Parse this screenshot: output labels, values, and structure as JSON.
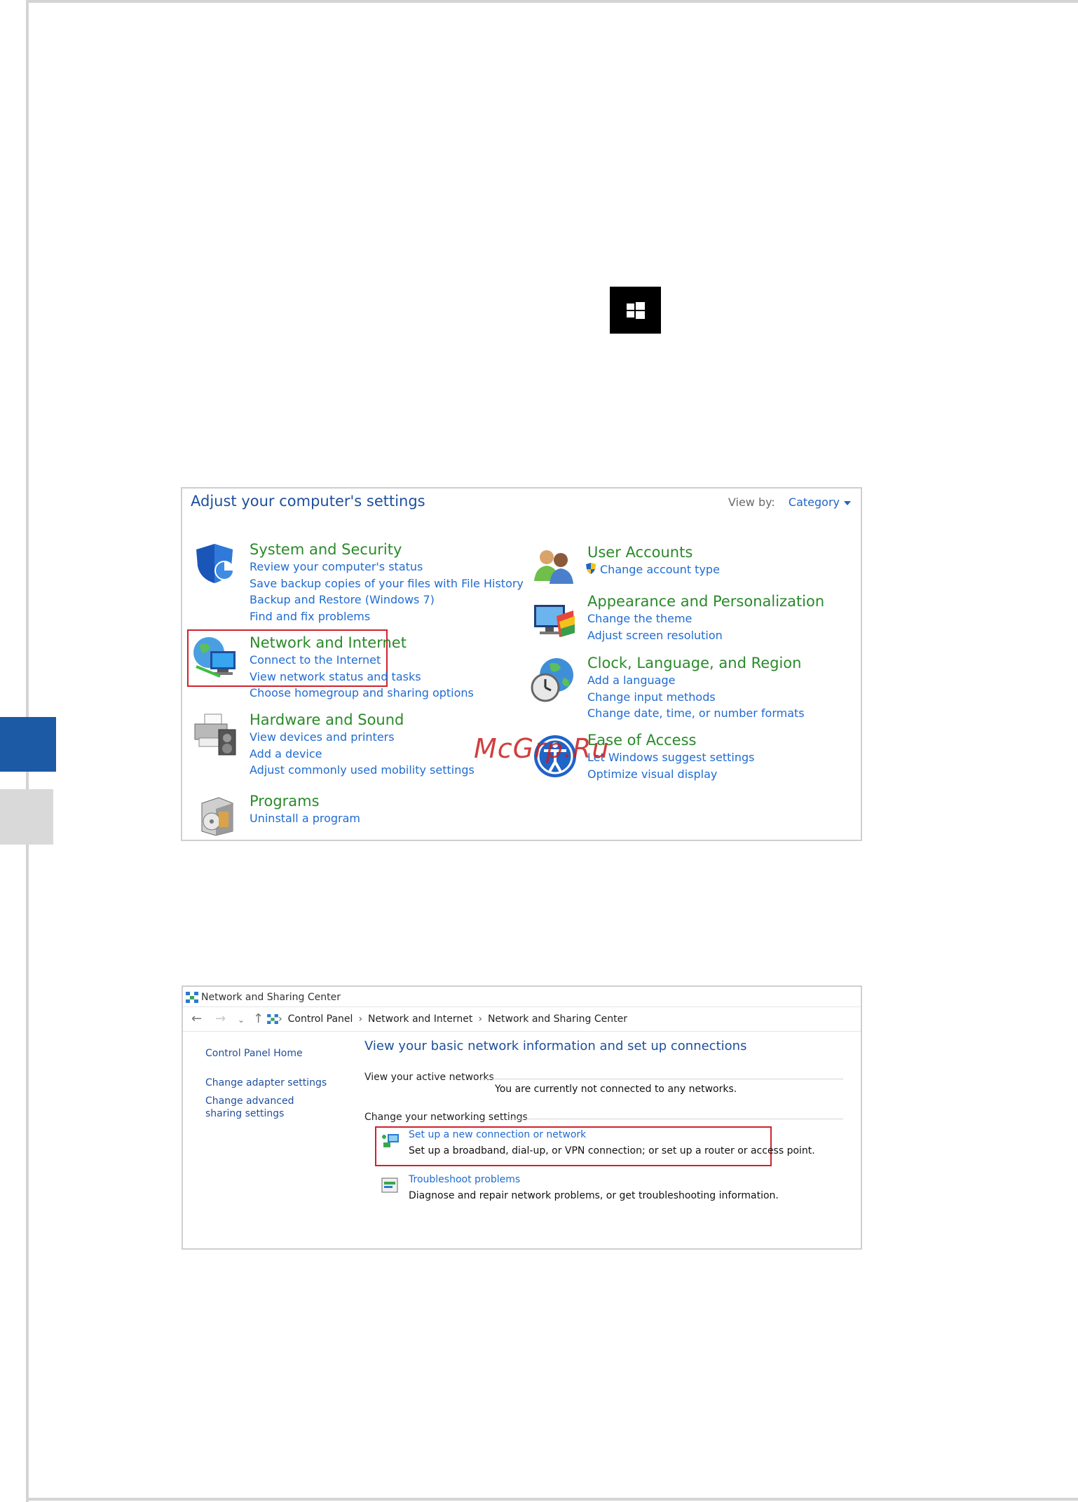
{
  "control_panel": {
    "title": "Adjust your computer's settings",
    "view_by_label": "View by:",
    "view_by_value": "Category",
    "categories": [
      {
        "heading": "System and Security",
        "links": [
          "Review your computer's status",
          "Save backup copies of your files with File History",
          "Backup and Restore (Windows 7)",
          "Find and fix problems"
        ]
      },
      {
        "heading": "Network and Internet",
        "links": [
          "Connect to the Internet",
          "View network status and tasks",
          "Choose homegroup and sharing options"
        ]
      },
      {
        "heading": "Hardware and Sound",
        "links": [
          "View devices and printers",
          "Add a device",
          "Adjust commonly used mobility settings"
        ]
      },
      {
        "heading": "Programs",
        "links": [
          "Uninstall a program"
        ]
      },
      {
        "heading": "User Accounts",
        "links": [
          "Change account type"
        ]
      },
      {
        "heading": "Appearance and Personalization",
        "links": [
          "Change the theme",
          "Adjust screen resolution"
        ]
      },
      {
        "heading": "Clock, Language, and Region",
        "links": [
          "Add a language",
          "Change input methods",
          "Change date, time, or number formats"
        ]
      },
      {
        "heading": "Ease of Access",
        "links": [
          "Let Windows suggest settings",
          "Optimize visual display"
        ]
      }
    ]
  },
  "network_center": {
    "window_title": "Network and Sharing Center",
    "breadcrumb": [
      "Control Panel",
      "Network and Internet",
      "Network and Sharing Center"
    ],
    "left_nav": [
      "Control Panel Home",
      "Change adapter settings",
      "Change advanced sharing settings"
    ],
    "heading": "View your basic network information and set up connections",
    "active_networks_label": "View your active networks",
    "not_connected_text": "You are currently not connected to any networks.",
    "change_settings_label": "Change your networking settings",
    "tasks": [
      {
        "link": "Set up a new connection or network",
        "desc": "Set up a broadband, dial-up, or VPN connection; or set up a router or access point."
      },
      {
        "link": "Troubleshoot problems",
        "desc": "Diagnose and repair network problems, or get troubleshooting information."
      }
    ]
  },
  "watermark": "McGrp.Ru"
}
